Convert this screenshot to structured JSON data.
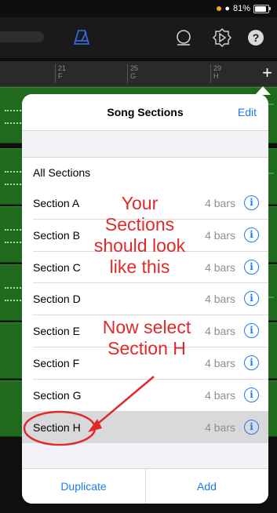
{
  "status": {
    "battery_text": "81%"
  },
  "ruler": {
    "marks": [
      {
        "num": "21",
        "letter": "F"
      },
      {
        "num": "25",
        "letter": "G"
      },
      {
        "num": "29",
        "letter": "H"
      }
    ],
    "add_glyph": "+"
  },
  "toolbar": {
    "help_glyph": "?"
  },
  "popover": {
    "title": "Song Sections",
    "edit": "Edit",
    "all_sections": "All Sections",
    "sections": [
      {
        "name": "Section A",
        "length": "4 bars"
      },
      {
        "name": "Section B",
        "length": "4 bars"
      },
      {
        "name": "Section C",
        "length": "4 bars"
      },
      {
        "name": "Section D",
        "length": "4 bars"
      },
      {
        "name": "Section E",
        "length": "4 bars"
      },
      {
        "name": "Section F",
        "length": "4 bars"
      },
      {
        "name": "Section G",
        "length": "4 bars"
      },
      {
        "name": "Section H",
        "length": "4 bars",
        "selected": true
      }
    ],
    "duplicate": "Duplicate",
    "add": "Add"
  },
  "annotations": {
    "note1": "Your\nSections\nshould look\nlike this",
    "note2": "Now select\nSection H"
  },
  "colors": {
    "accent": "#1a7cf0",
    "annotation": "#e02a2a",
    "track_green": "#1f6a1c"
  },
  "icons": [
    "metronome-icon",
    "loop-icon",
    "settings-dial-icon",
    "help-icon",
    "info-icon",
    "wifi-icon",
    "battery-icon"
  ]
}
